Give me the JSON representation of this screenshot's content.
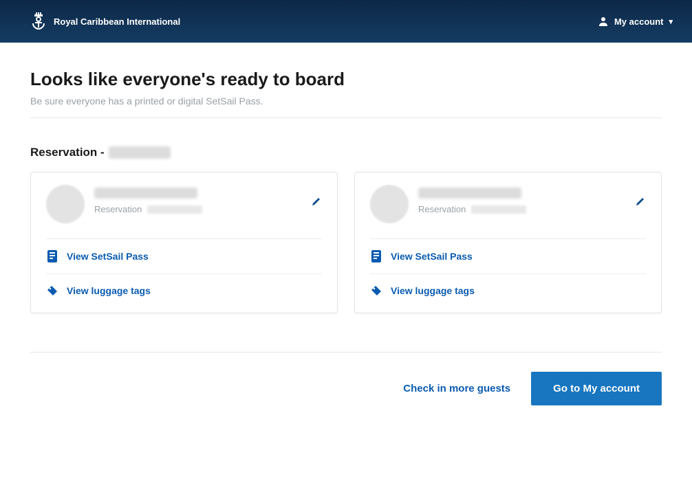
{
  "header": {
    "brand": "Royal Caribbean International",
    "account_label": "My account"
  },
  "main": {
    "title": "Looks like everyone's ready to board",
    "subtitle": "Be sure everyone has a printed or digital SetSail Pass.",
    "reservation_prefix": "Reservation -"
  },
  "guests": [
    {
      "reservation_label": "Reservation",
      "setsail_label": "View SetSail Pass",
      "luggage_label": "View luggage tags"
    },
    {
      "reservation_label": "Reservation",
      "setsail_label": "View SetSail Pass",
      "luggage_label": "View luggage tags"
    }
  ],
  "footer": {
    "check_more": "Check in more guests",
    "go_account": "Go to My account"
  },
  "colors": {
    "accent": "#0a5bb0",
    "primary_button": "#1876c0",
    "header_bg": "#153c63"
  }
}
